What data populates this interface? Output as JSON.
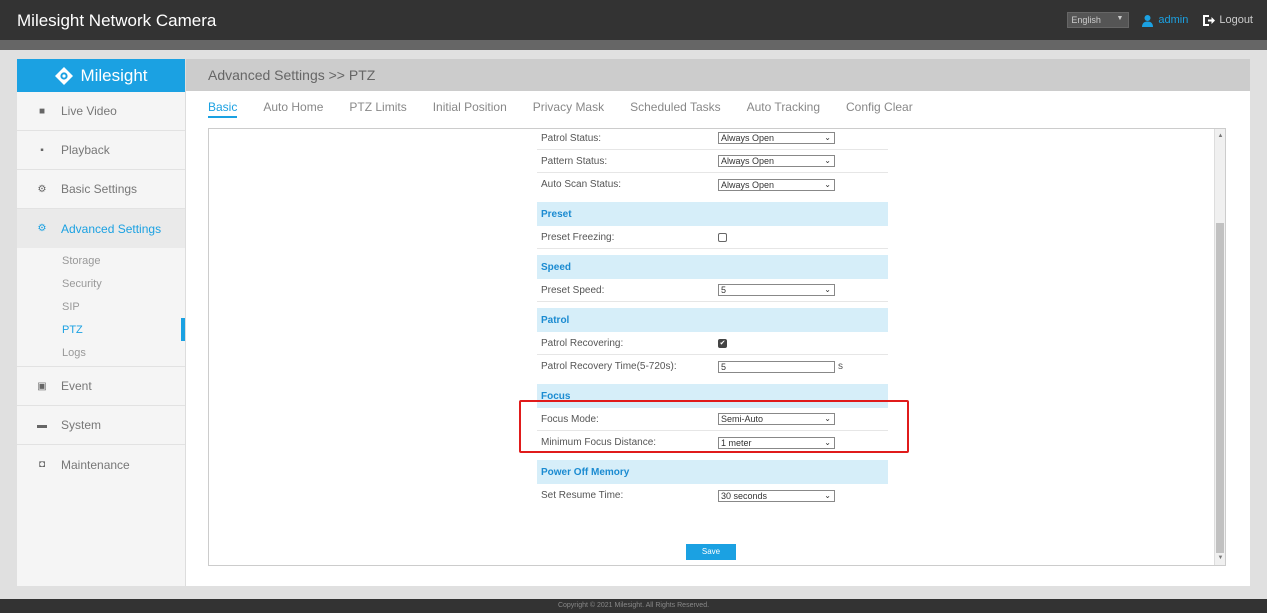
{
  "app": {
    "title": "Milesight Network Camera"
  },
  "topbar": {
    "language": "English",
    "user": "admin",
    "logout": "Logout"
  },
  "sidebar": {
    "logo": "Milesight",
    "items": [
      {
        "label": "Live Video",
        "icon": "video-icon"
      },
      {
        "label": "Playback",
        "icon": "playback-icon"
      },
      {
        "label": "Basic Settings",
        "icon": "gear-icon"
      },
      {
        "label": "Advanced Settings",
        "icon": "gears-icon",
        "active": true
      },
      {
        "label": "Event",
        "icon": "event-icon"
      },
      {
        "label": "System",
        "icon": "monitor-icon"
      },
      {
        "label": "Maintenance",
        "icon": "camera-icon"
      }
    ],
    "subitems": [
      "Storage",
      "Security",
      "SIP",
      "PTZ",
      "Logs"
    ]
  },
  "main": {
    "breadcrumb": "Advanced Settings >> PTZ",
    "tabs": [
      "Basic",
      "Auto Home",
      "PTZ Limits",
      "Initial Position",
      "Privacy Mask",
      "Scheduled Tasks",
      "Auto Tracking",
      "Config Clear"
    ],
    "active_tab": "Basic"
  },
  "form": {
    "patrol_status": {
      "label": "Patrol Status:",
      "value": "Always Open"
    },
    "pattern_status": {
      "label": "Pattern Status:",
      "value": "Always Open"
    },
    "auto_scan_status": {
      "label": "Auto Scan Status:",
      "value": "Always Open"
    },
    "preset_section": "Preset",
    "preset_freezing": {
      "label": "Preset Freezing:",
      "checked": false
    },
    "speed_section": "Speed",
    "preset_speed": {
      "label": "Preset Speed:",
      "value": "5"
    },
    "patrol_section": "Patrol",
    "patrol_recovering": {
      "label": "Patrol Recovering:",
      "checked": true
    },
    "patrol_recovery_time": {
      "label": "Patrol Recovery Time(5-720s):",
      "value": "5",
      "unit": "s"
    },
    "focus_section": "Focus",
    "focus_mode": {
      "label": "Focus Mode:",
      "value": "Semi-Auto"
    },
    "min_focus_distance": {
      "label": "Minimum Focus Distance:",
      "value": "1 meter"
    },
    "power_section": "Power Off Memory",
    "set_resume_time": {
      "label": "Set Resume Time:",
      "value": "30 seconds"
    },
    "save_label": "Save"
  },
  "footer": {
    "copyright": "Copyright © 2021 Milesight. All Rights Reserved."
  },
  "colors": {
    "accent": "#1ba1e2",
    "highlight": "#e01b1b",
    "section_bg": "#d6eef9"
  }
}
